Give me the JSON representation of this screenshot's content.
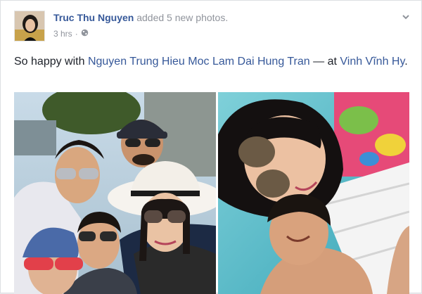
{
  "post": {
    "author": "Truc Thu Nguyen",
    "action": "added 5 new photos.",
    "timestamp": "3 hrs",
    "separator": "·",
    "privacy_icon": "globe-icon",
    "text_prefix": "So happy with ",
    "tagged": [
      "Nguyen Trung Hieu",
      "Moc Lam",
      "Dai Hung Tran"
    ],
    "separator_at": " — at ",
    "location": "Vinh Vĩnh Hy",
    "text_suffix": "."
  },
  "photos": [
    {
      "name": "group-selfie-photo"
    },
    {
      "name": "couple-selfie-photo"
    }
  ],
  "colors": {
    "link": "#365899",
    "meta": "#90949c",
    "text": "#1d2129"
  }
}
